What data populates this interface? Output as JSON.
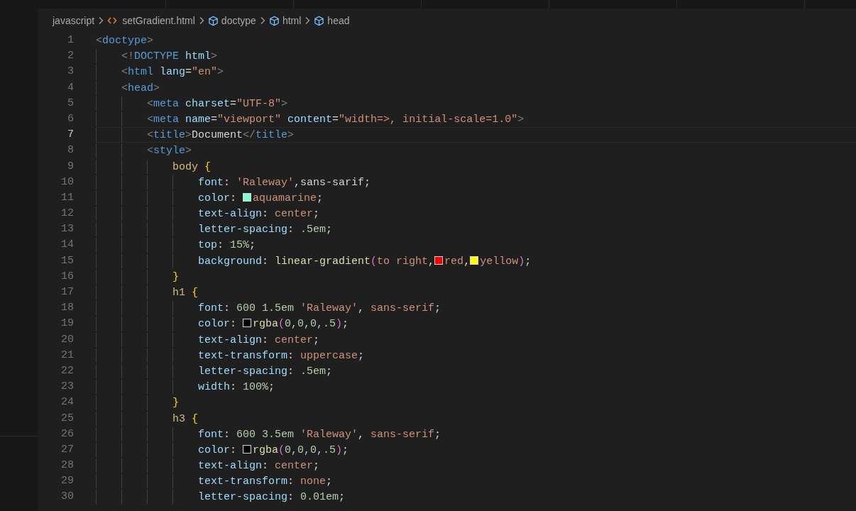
{
  "breadcrumbs": [
    {
      "kind": "folder",
      "label": "javascript"
    },
    {
      "kind": "file",
      "label": "setGradient.html"
    },
    {
      "kind": "element",
      "label": "doctype"
    },
    {
      "kind": "element",
      "label": "html"
    },
    {
      "kind": "element",
      "label": "head"
    }
  ],
  "lines": [
    {
      "number": "1",
      "current": false,
      "tokens": [
        {
          "kind": "punct",
          "text": "<"
        },
        {
          "kind": "tag",
          "text": "doctype"
        },
        {
          "kind": "punct",
          "text": ">"
        }
      ],
      "children": [
        {
          "number": "2",
          "current": false,
          "tokens": [
            {
              "kind": "punct",
              "text": "<!"
            },
            {
              "kind": "tag",
              "text": "DOCTYPE"
            },
            {
              "kind": "attr",
              "text": " html"
            },
            {
              "kind": "punct",
              "text": ">"
            }
          ]
        },
        {
          "number": "3",
          "current": false,
          "tokens": [
            {
              "kind": "punct",
              "text": "<"
            },
            {
              "kind": "tag",
              "text": "html"
            },
            {
              "kind": "attr",
              "text": " lang"
            },
            {
              "kind": "text",
              "text": "="
            },
            {
              "kind": "string",
              "text": "\"en\""
            },
            {
              "kind": "punct",
              "text": ">"
            }
          ]
        },
        {
          "number": "4",
          "current": false,
          "tokens": [
            {
              "kind": "punct",
              "text": "<"
            },
            {
              "kind": "tag",
              "text": "head"
            },
            {
              "kind": "punct",
              "text": ">"
            }
          ],
          "children": [
            {
              "number": "5",
              "current": false,
              "tokens": [
                {
                  "kind": "punct",
                  "text": "<"
                },
                {
                  "kind": "tag",
                  "text": "meta"
                },
                {
                  "kind": "attr",
                  "text": " charset"
                },
                {
                  "kind": "text",
                  "text": "="
                },
                {
                  "kind": "string",
                  "text": "\"UTF-8\""
                },
                {
                  "kind": "punct",
                  "text": ">"
                }
              ]
            },
            {
              "number": "6",
              "current": false,
              "tokens": [
                {
                  "kind": "punct",
                  "text": "<"
                },
                {
                  "kind": "tag",
                  "text": "meta"
                },
                {
                  "kind": "attr",
                  "text": " name"
                },
                {
                  "kind": "text",
                  "text": "="
                },
                {
                  "kind": "string",
                  "text": "\"viewport\""
                },
                {
                  "kind": "attr",
                  "text": " content"
                },
                {
                  "kind": "text",
                  "text": "="
                },
                {
                  "kind": "string",
                  "text": "\"width=>, initial-scale=1.0\""
                },
                {
                  "kind": "punct",
                  "text": ">"
                }
              ]
            },
            {
              "number": "7",
              "current": true,
              "tokens": [
                {
                  "kind": "punct",
                  "text": "<"
                },
                {
                  "kind": "tag",
                  "text": "title"
                },
                {
                  "kind": "punct",
                  "text": ">"
                },
                {
                  "kind": "text",
                  "text": "Document"
                },
                {
                  "kind": "punct",
                  "text": "</"
                },
                {
                  "kind": "tag",
                  "text": "title"
                },
                {
                  "kind": "punct",
                  "text": ">"
                }
              ]
            },
            {
              "number": "8",
              "current": false,
              "tokens": [
                {
                  "kind": "punct",
                  "text": "<"
                },
                {
                  "kind": "tag",
                  "text": "style"
                },
                {
                  "kind": "punct",
                  "text": ">"
                }
              ],
              "children": [
                {
                  "number": "9",
                  "current": false,
                  "tokens": [
                    {
                      "kind": "selector",
                      "text": "body"
                    },
                    {
                      "kind": "brace",
                      "text": " {"
                    }
                  ],
                  "children": [
                    {
                      "number": "10",
                      "current": false,
                      "tokens": [
                        {
                          "kind": "prop",
                          "text": "font"
                        },
                        {
                          "kind": "text",
                          "text": ": "
                        },
                        {
                          "kind": "value",
                          "text": "'Raleway'"
                        },
                        {
                          "kind": "text",
                          "text": ",sans-sarif;"
                        }
                      ]
                    },
                    {
                      "number": "11",
                      "current": false,
                      "tokens": [
                        {
                          "kind": "prop",
                          "text": "color"
                        },
                        {
                          "kind": "text",
                          "text": ": "
                        },
                        {
                          "kind": "swatch",
                          "color": "#7fffd4"
                        },
                        {
                          "kind": "value",
                          "text": "aquamarine"
                        },
                        {
                          "kind": "text",
                          "text": ";"
                        }
                      ]
                    },
                    {
                      "number": "12",
                      "current": false,
                      "tokens": [
                        {
                          "kind": "prop",
                          "text": "text-align"
                        },
                        {
                          "kind": "text",
                          "text": ": "
                        },
                        {
                          "kind": "value",
                          "text": "center"
                        },
                        {
                          "kind": "text",
                          "text": ";"
                        }
                      ]
                    },
                    {
                      "number": "13",
                      "current": false,
                      "tokens": [
                        {
                          "kind": "prop",
                          "text": "letter-spacing"
                        },
                        {
                          "kind": "text",
                          "text": ": "
                        },
                        {
                          "kind": "number",
                          "text": ".5em"
                        },
                        {
                          "kind": "text",
                          "text": ";"
                        }
                      ]
                    },
                    {
                      "number": "14",
                      "current": false,
                      "tokens": [
                        {
                          "kind": "prop",
                          "text": "top"
                        },
                        {
                          "kind": "text",
                          "text": ": "
                        },
                        {
                          "kind": "number",
                          "text": "15%"
                        },
                        {
                          "kind": "text",
                          "text": ";"
                        }
                      ]
                    },
                    {
                      "number": "15",
                      "current": false,
                      "tokens": [
                        {
                          "kind": "prop",
                          "text": "background"
                        },
                        {
                          "kind": "text",
                          "text": ": "
                        },
                        {
                          "kind": "func",
                          "text": "linear-gradient"
                        },
                        {
                          "kind": "paren",
                          "text": "("
                        },
                        {
                          "kind": "value",
                          "text": "to right"
                        },
                        {
                          "kind": "text",
                          "text": ","
                        },
                        {
                          "kind": "swatch",
                          "color": "#ff0000"
                        },
                        {
                          "kind": "value",
                          "text": "red"
                        },
                        {
                          "kind": "text",
                          "text": ","
                        },
                        {
                          "kind": "swatch",
                          "color": "#ffff00"
                        },
                        {
                          "kind": "value",
                          "text": "yellow"
                        },
                        {
                          "kind": "paren",
                          "text": ")"
                        },
                        {
                          "kind": "text",
                          "text": ";"
                        }
                      ]
                    }
                  ]
                },
                {
                  "number": "16",
                  "current": false,
                  "tokens": [
                    {
                      "kind": "brace",
                      "text": "}"
                    }
                  ]
                },
                {
                  "number": "17",
                  "current": false,
                  "tokens": [
                    {
                      "kind": "selector",
                      "text": "h1"
                    },
                    {
                      "kind": "brace",
                      "text": " {"
                    }
                  ],
                  "children": [
                    {
                      "number": "18",
                      "current": false,
                      "tokens": [
                        {
                          "kind": "prop",
                          "text": "font"
                        },
                        {
                          "kind": "text",
                          "text": ": "
                        },
                        {
                          "kind": "number",
                          "text": "600 1.5em"
                        },
                        {
                          "kind": "value",
                          "text": " 'Raleway'"
                        },
                        {
                          "kind": "text",
                          "text": ", "
                        },
                        {
                          "kind": "value",
                          "text": "sans-serif"
                        },
                        {
                          "kind": "text",
                          "text": ";"
                        }
                      ]
                    },
                    {
                      "number": "19",
                      "current": false,
                      "tokens": [
                        {
                          "kind": "prop",
                          "text": "color"
                        },
                        {
                          "kind": "text",
                          "text": ": "
                        },
                        {
                          "kind": "swatch",
                          "color": "#000000"
                        },
                        {
                          "kind": "func",
                          "text": "rgba"
                        },
                        {
                          "kind": "paren",
                          "text": "("
                        },
                        {
                          "kind": "number",
                          "text": "0,0,0,.5"
                        },
                        {
                          "kind": "paren",
                          "text": ")"
                        },
                        {
                          "kind": "text",
                          "text": ";"
                        }
                      ]
                    },
                    {
                      "number": "20",
                      "current": false,
                      "tokens": [
                        {
                          "kind": "prop",
                          "text": "text-align"
                        },
                        {
                          "kind": "text",
                          "text": ": "
                        },
                        {
                          "kind": "value",
                          "text": "center"
                        },
                        {
                          "kind": "text",
                          "text": ";"
                        }
                      ]
                    },
                    {
                      "number": "21",
                      "current": false,
                      "tokens": [
                        {
                          "kind": "prop",
                          "text": "text-transform"
                        },
                        {
                          "kind": "text",
                          "text": ": "
                        },
                        {
                          "kind": "value",
                          "text": "uppercase"
                        },
                        {
                          "kind": "text",
                          "text": ";"
                        }
                      ]
                    },
                    {
                      "number": "22",
                      "current": false,
                      "tokens": [
                        {
                          "kind": "prop",
                          "text": "letter-spacing"
                        },
                        {
                          "kind": "text",
                          "text": ": "
                        },
                        {
                          "kind": "number",
                          "text": ".5em"
                        },
                        {
                          "kind": "text",
                          "text": ";"
                        }
                      ]
                    },
                    {
                      "number": "23",
                      "current": false,
                      "tokens": [
                        {
                          "kind": "prop",
                          "text": "width"
                        },
                        {
                          "kind": "text",
                          "text": ": "
                        },
                        {
                          "kind": "number",
                          "text": "100%"
                        },
                        {
                          "kind": "text",
                          "text": ";"
                        }
                      ]
                    }
                  ]
                },
                {
                  "number": "24",
                  "current": false,
                  "tokens": [
                    {
                      "kind": "brace",
                      "text": "}"
                    }
                  ]
                },
                {
                  "number": "25",
                  "current": false,
                  "tokens": [
                    {
                      "kind": "selector",
                      "text": "h3"
                    },
                    {
                      "kind": "brace",
                      "text": " {"
                    }
                  ],
                  "children": [
                    {
                      "number": "26",
                      "current": false,
                      "tokens": [
                        {
                          "kind": "prop",
                          "text": "font"
                        },
                        {
                          "kind": "text",
                          "text": ": "
                        },
                        {
                          "kind": "number",
                          "text": "600 3.5em"
                        },
                        {
                          "kind": "value",
                          "text": " 'Raleway'"
                        },
                        {
                          "kind": "text",
                          "text": ", "
                        },
                        {
                          "kind": "value",
                          "text": "sans-serif"
                        },
                        {
                          "kind": "text",
                          "text": ";"
                        }
                      ]
                    },
                    {
                      "number": "27",
                      "current": false,
                      "tokens": [
                        {
                          "kind": "prop",
                          "text": "color"
                        },
                        {
                          "kind": "text",
                          "text": ": "
                        },
                        {
                          "kind": "swatch",
                          "color": "#000000"
                        },
                        {
                          "kind": "func",
                          "text": "rgba"
                        },
                        {
                          "kind": "paren",
                          "text": "("
                        },
                        {
                          "kind": "number",
                          "text": "0,0,0,.5"
                        },
                        {
                          "kind": "paren",
                          "text": ")"
                        },
                        {
                          "kind": "text",
                          "text": ";"
                        }
                      ]
                    },
                    {
                      "number": "28",
                      "current": false,
                      "tokens": [
                        {
                          "kind": "prop",
                          "text": "text-align"
                        },
                        {
                          "kind": "text",
                          "text": ": "
                        },
                        {
                          "kind": "value",
                          "text": "center"
                        },
                        {
                          "kind": "text",
                          "text": ";"
                        }
                      ]
                    },
                    {
                      "number": "29",
                      "current": false,
                      "tokens": [
                        {
                          "kind": "prop",
                          "text": "text-transform"
                        },
                        {
                          "kind": "text",
                          "text": ": "
                        },
                        {
                          "kind": "value",
                          "text": "none"
                        },
                        {
                          "kind": "text",
                          "text": ";"
                        }
                      ]
                    },
                    {
                      "number": "30",
                      "current": false,
                      "tokens": [
                        {
                          "kind": "prop",
                          "text": "letter-spacing"
                        },
                        {
                          "kind": "text",
                          "text": ": "
                        },
                        {
                          "kind": "number",
                          "text": "0.01em"
                        },
                        {
                          "kind": "text",
                          "text": ";"
                        }
                      ]
                    }
                  ]
                }
              ]
            }
          ]
        }
      ]
    }
  ]
}
